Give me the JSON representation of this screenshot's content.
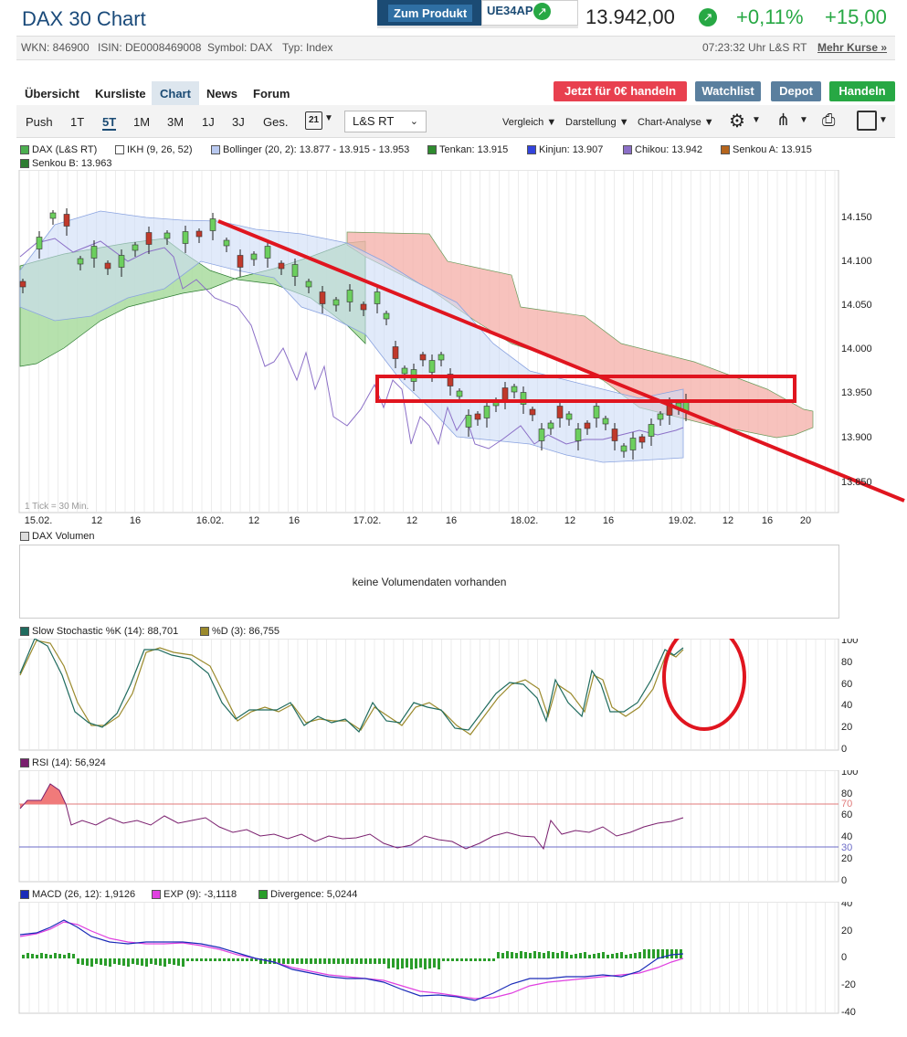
{
  "header": {
    "title": "DAX 30 Chart",
    "product_button": "Zum Produkt",
    "product_isin": "UE34AP",
    "price": "13.942,00",
    "change_pct": "+0,11%",
    "change_abs": "+15,00"
  },
  "meta": {
    "wkn": "WKN: 846900",
    "isin": "ISIN: DE0008469008",
    "symbol": "Symbol: DAX",
    "type": "Typ: Index",
    "time": "07:23:32 Uhr L&S RT",
    "more_link": "Mehr Kurse »"
  },
  "nav": {
    "tabs": [
      "Übersicht",
      "Kursliste",
      "Chart",
      "News",
      "Forum"
    ],
    "active": "Chart"
  },
  "actions": {
    "trade_free": "Jetzt für 0€ handeln",
    "watchlist": "Watchlist",
    "depot": "Depot",
    "handeln": "Handeln"
  },
  "toolbar": {
    "ranges": [
      "Push",
      "1T",
      "5T",
      "1M",
      "3M",
      "1J",
      "3J",
      "Ges."
    ],
    "active_range": "5T",
    "calendar_day": "21",
    "exchange": "L&S RT",
    "vergleich": "Vergleich",
    "darstellung": "Darstellung",
    "chartanalyse": "Chart-Analyse"
  },
  "legend": {
    "dax": "DAX (L&S RT)",
    "ikh": "IKH (9, 26, 52)",
    "bollinger": "Bollinger (20, 2): 13.877 - 13.915 - 13.953",
    "tenkan": "Tenkan: 13.915",
    "kinjun": "Kinjun: 13.907",
    "chikou": "Chikou: 13.942",
    "senkou_a": "Senkou A: 13.915",
    "senkou_b": "Senkou B: 13.963"
  },
  "main_chart": {
    "y_ticks": [
      "14.150",
      "14.100",
      "14.050",
      "14.000",
      "13.950",
      "13.900",
      "13.850"
    ],
    "x_ticks": [
      "15.02.",
      "12",
      "16",
      "16.02.",
      "12",
      "16",
      "17.02.",
      "12",
      "16",
      "18.02.",
      "12",
      "16",
      "19.02.",
      "12",
      "16",
      "20"
    ],
    "tick_note": "1 Tick = 30 Min."
  },
  "volume": {
    "label": "DAX Volumen",
    "empty": "keine Volumendaten vorhanden"
  },
  "stochastic": {
    "k_label": "Slow Stochastic %K (14): 88,701",
    "d_label": "%D (3): 86,755",
    "y_ticks": [
      "100",
      "80",
      "60",
      "40",
      "20",
      "0"
    ]
  },
  "rsi": {
    "label": "RSI (14): 56,924",
    "y_ticks": [
      "100",
      "80",
      "70",
      "60",
      "40",
      "30",
      "20",
      "0"
    ]
  },
  "macd": {
    "macd_label": "MACD (26, 12): 1,9126",
    "exp_label": "EXP (9): -3,1118",
    "div_label": "Divergence: 5,0244",
    "y_ticks": [
      "40",
      "20",
      "0",
      "-20",
      "-40"
    ]
  },
  "colors": {
    "brand": "#1b4b74",
    "positive": "#27a844",
    "trade_red": "#e8404f",
    "button_blue": "#5a7f9e",
    "annotation": "#e0151f"
  }
}
